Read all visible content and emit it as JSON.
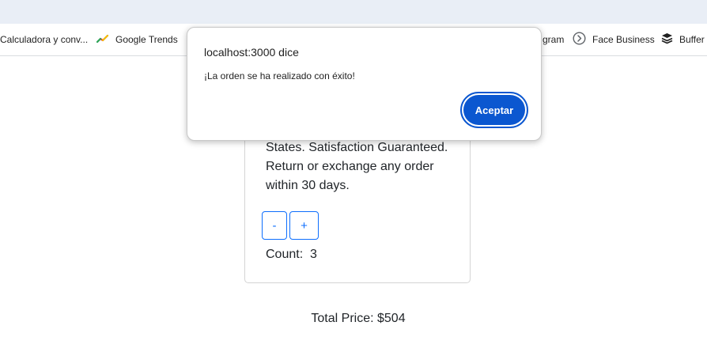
{
  "browser": {
    "bookmarks": [
      {
        "label": "Calculadora y conv...",
        "icon": "calculator-icon"
      },
      {
        "label": "Google Trends",
        "icon": "google-trends-icon"
      },
      {
        "label": "gram",
        "icon": "instagram-icon"
      },
      {
        "label": "Face Business",
        "icon": "face-business-icon"
      },
      {
        "label": "Buffer",
        "icon": "buffer-icon"
      }
    ]
  },
  "product_card": {
    "description": "States. Satisfaction Guaranteed. Return or exchange any order within 30 days.",
    "decrement_label": "-",
    "increment_label": "+",
    "count_label": "Count:",
    "count_value": "3"
  },
  "total": {
    "label": "Total Price: $504"
  },
  "alert": {
    "title": "localhost:3000 dice",
    "message": "¡La orden se ha realizado con éxito!",
    "accept_label": "Aceptar"
  },
  "colors": {
    "accent": "#0b57d0",
    "primary_outline": "#0d6efd",
    "top_strip": "#e9eef6"
  }
}
